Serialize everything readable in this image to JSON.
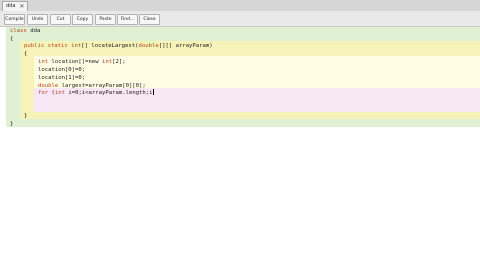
{
  "tab": {
    "name": "dda",
    "close": "✕"
  },
  "toolbar": {
    "buttons": [
      "Compile",
      "Undo",
      "Cut",
      "Copy",
      "Paste",
      "Find...",
      "Close"
    ]
  },
  "code": {
    "class_line_kw": "class",
    "class_line_name": " dda",
    "open_brace_1": "{",
    "method_kw": "public static int",
    "method_mid": "[] locateLargest(",
    "method_type": "double",
    "method_end": "[][] arrayParam)",
    "open_brace_2": "{",
    "l1_kw": "int",
    "l1_mid": " location[]=new ",
    "l1_kw2": "int",
    "l1_end": "[2];",
    "l2": "location[0]=0;",
    "l3": "location[1]=0;",
    "l4_kw": "double",
    "l4_end": " largest=arrayParam[0][0];",
    "l5_kw": "for",
    "l5_mid": " (",
    "l5_kw2": "int",
    "l5_end": " i=0;i<arrayParam.length;i",
    "close_brace_2": "}",
    "close_brace_1": "}"
  },
  "colors": {
    "class_bg": "#dff0d3",
    "method_bg": "#f7f3b8",
    "body_bg": "#fffde4",
    "loop_bg": "#f7e6f3"
  }
}
